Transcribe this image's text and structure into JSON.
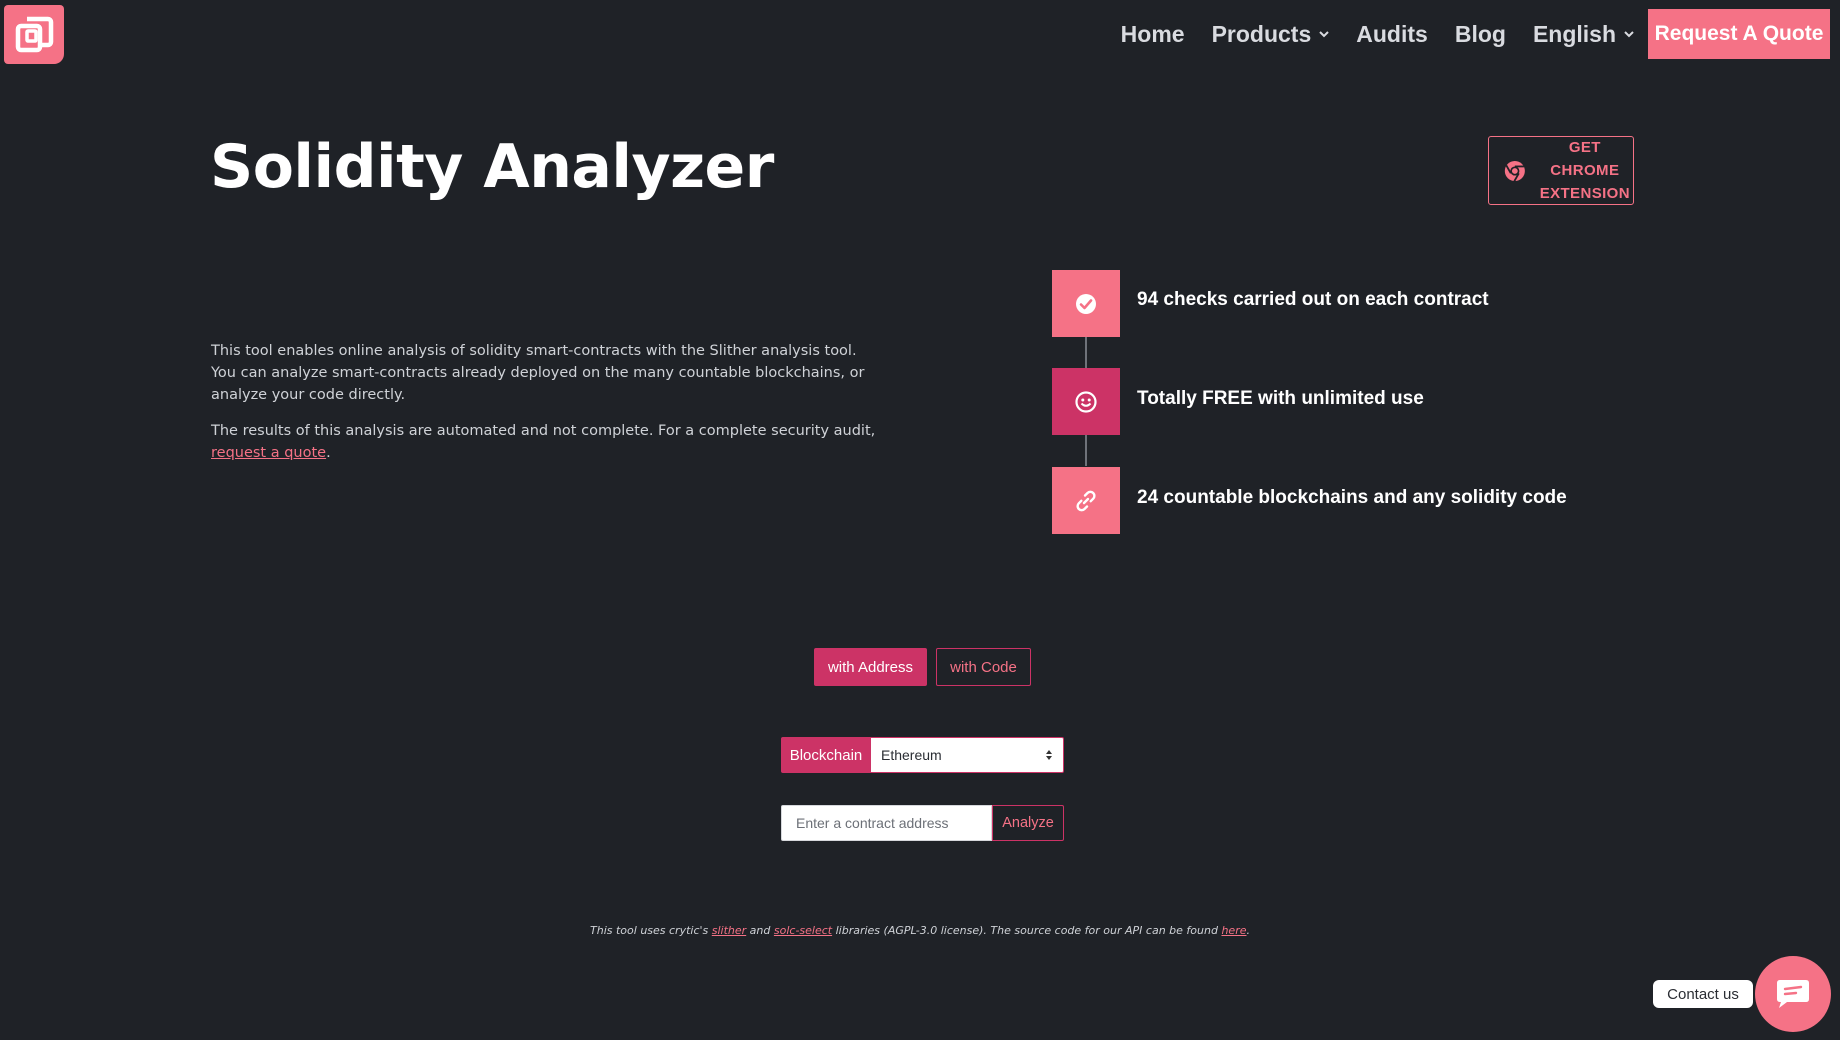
{
  "header": {
    "logo_icon": "overlapping-squares-logo-icon",
    "nav": [
      {
        "label": "Home",
        "has_dropdown": false
      },
      {
        "label": "Products",
        "has_dropdown": true
      },
      {
        "label": "Audits",
        "has_dropdown": false
      },
      {
        "label": "Blog",
        "has_dropdown": false
      },
      {
        "label": "English",
        "has_dropdown": true
      }
    ],
    "cta_label": "Request A Quote"
  },
  "hero": {
    "title": "Solidity Analyzer",
    "chrome_button": {
      "line1": "GET CHROME",
      "line2": "EXTENSION",
      "icon": "chrome-icon"
    }
  },
  "description": {
    "p1": "This tool enables online analysis of solidity smart-contracts with the Slither analysis tool. You can analyze smart-contracts already deployed on the many countable blockchains, or analyze your code directly.",
    "p2_text": "The results of this analysis are automated and not complete. For a complete security audit, ",
    "p2_link": "request a quote",
    "p2_end": "."
  },
  "features": [
    {
      "text": "94 checks carried out on each contract",
      "icon": "check-circle-icon",
      "color": "#f57286"
    },
    {
      "text": "Totally FREE with unlimited use",
      "icon": "smiley-icon",
      "color": "#cc3366"
    },
    {
      "text": "24 countable blockchains and any solidity code",
      "icon": "link-icon",
      "color": "#f57286"
    }
  ],
  "tabs": {
    "active": "with Address",
    "inactive": "with Code"
  },
  "form": {
    "blockchain_label": "Blockchain",
    "blockchain_selected": "Ethereum",
    "address_placeholder": "Enter a contract address",
    "analyze_label": "Analyze"
  },
  "footnote": {
    "t1": "This tool uses crytic's ",
    "link1": "slither",
    "t2": " and ",
    "link2": "solc-select",
    "t3": " libraries (AGPL-3.0 license). The source code for our API can be found ",
    "link3": "here",
    "t4": "."
  },
  "contact": {
    "label": "Contact us",
    "icon": "chat-bubble-icon"
  },
  "colors": {
    "background": "#1f2227",
    "accent_pink": "#f57286",
    "accent_magenta": "#cc3366"
  }
}
